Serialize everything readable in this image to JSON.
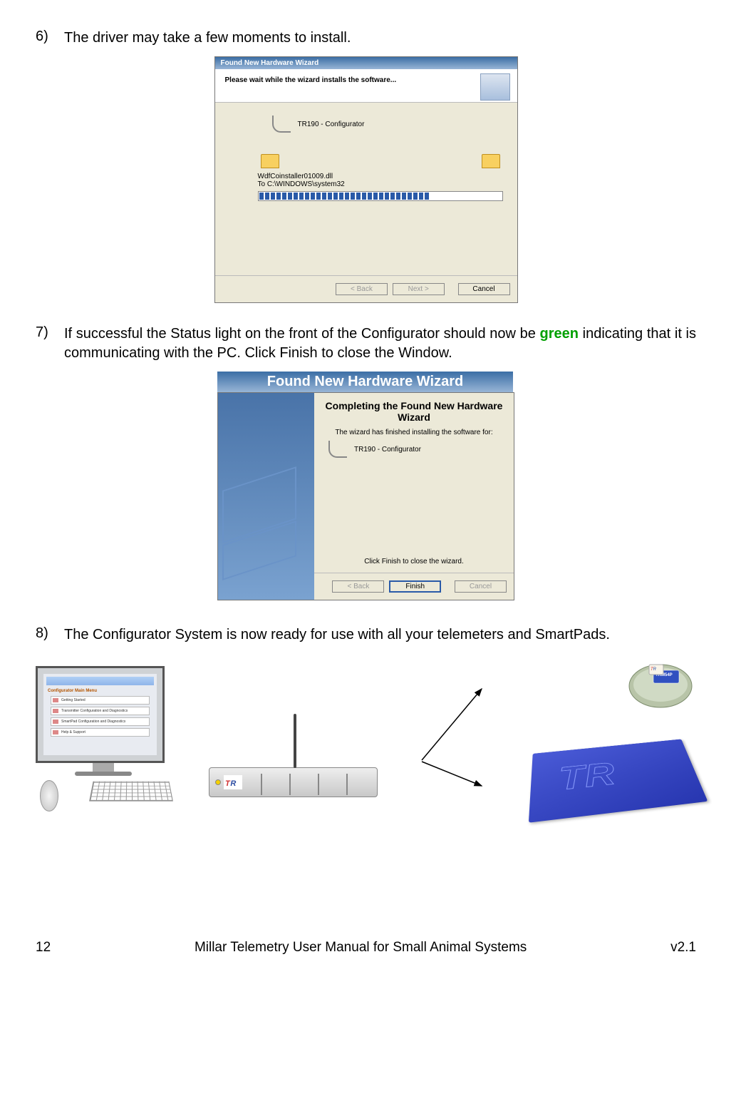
{
  "steps": {
    "s6": {
      "num": "6)",
      "text": "The driver may take a few moments to install."
    },
    "s7": {
      "num": "7)",
      "text_before": "If  successful  the  Status  light  on  the  front  of  the  Configurator  should  now  be",
      "green_word": "green",
      "text_after": "indicating that it is communicating with the PC.  Click Finish to close the Window."
    },
    "s8": {
      "num": "8)",
      "text": "The Configurator System is now ready for use with all your telemeters and SmartPads."
    }
  },
  "wizard1": {
    "title": "Found New Hardware Wizard",
    "header": "Please wait while the wizard installs the software...",
    "device": "TR190 - Configurator",
    "file": "WdfCoinstaller01009.dll",
    "dest": "To C:\\WINDOWS\\system32",
    "btn_back": "< Back",
    "btn_next": "Next >",
    "btn_cancel": "Cancel"
  },
  "wizard2": {
    "title": "Found New Hardware Wizard",
    "heading": "Completing the Found New Hardware Wizard",
    "msg": "The wizard has finished installing the software for:",
    "device": "TR190 - Configurator",
    "close_msg": "Click Finish to close the wizard.",
    "btn_back": "< Back",
    "btn_finish": "Finish",
    "btn_cancel": "Cancel"
  },
  "monitor_app": {
    "title": "Configurator Main Menu",
    "item1": "Getting Started",
    "item2": "Transmitter Configuration and Diagnostics",
    "item3": "SmartPad Configuration and Diagnostics",
    "item4": "Help & Support"
  },
  "hub_logo": "TR",
  "telemeter_label": "TRM54P",
  "footer": {
    "page": "12",
    "title": "Millar Telemetry User Manual for Small Animal Systems",
    "version": "v2.1"
  }
}
